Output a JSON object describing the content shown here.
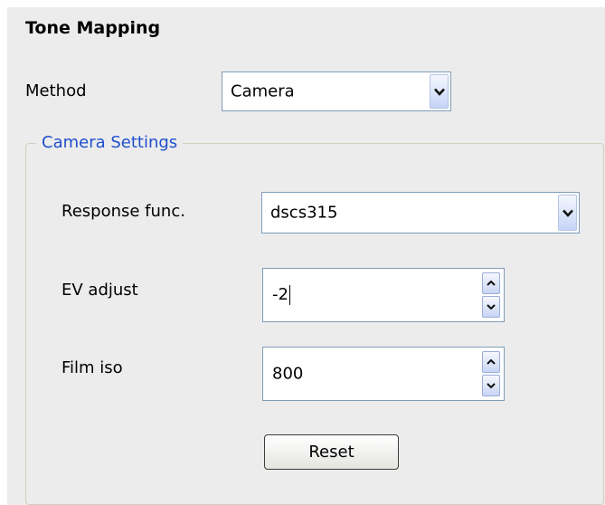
{
  "section_title": "Tone Mapping",
  "method": {
    "label": "Method",
    "value": "Camera",
    "icon": "chevron-down-icon"
  },
  "camera_settings": {
    "group_label": "Camera Settings",
    "response_func": {
      "label": "Response func.",
      "value": "dscs315",
      "icon": "chevron-down-icon"
    },
    "ev_adjust": {
      "label": "EV adjust",
      "value": "-2"
    },
    "film_iso": {
      "label": "Film iso",
      "value": "800"
    },
    "reset_label": "Reset"
  },
  "colors": {
    "panel_bg": "#ececec",
    "group_label": "#1f4fcc",
    "field_border": "#7f9db9"
  }
}
